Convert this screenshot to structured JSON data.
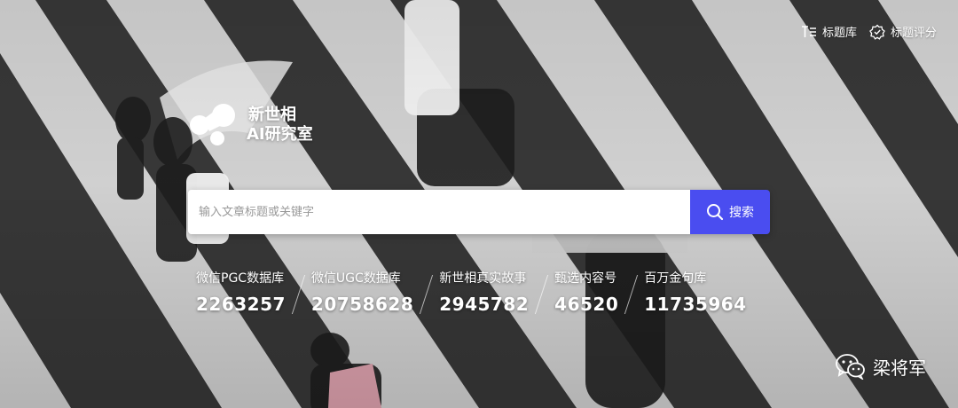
{
  "header": {
    "links": [
      {
        "label": "标题库",
        "icon": "list-title-icon"
      },
      {
        "label": "标题评分",
        "icon": "score-badge-icon"
      }
    ]
  },
  "logo": {
    "line1": "新世相",
    "line2": "AI研究室"
  },
  "search": {
    "placeholder": "输入文章标题或关键字",
    "button_label": "搜索",
    "button_color": "#4a4df0"
  },
  "stats": [
    {
      "label": "微信PGC数据库",
      "value": "2263257"
    },
    {
      "label": "微信UGC数据库",
      "value": "20758628"
    },
    {
      "label": "新世相真实故事",
      "value": "2945782"
    },
    {
      "label": "甄选内容号",
      "value": "46520"
    },
    {
      "label": "百万金句库",
      "value": "11735964"
    }
  ],
  "watermark": {
    "text": "梁将军",
    "icon": "wechat-icon"
  }
}
